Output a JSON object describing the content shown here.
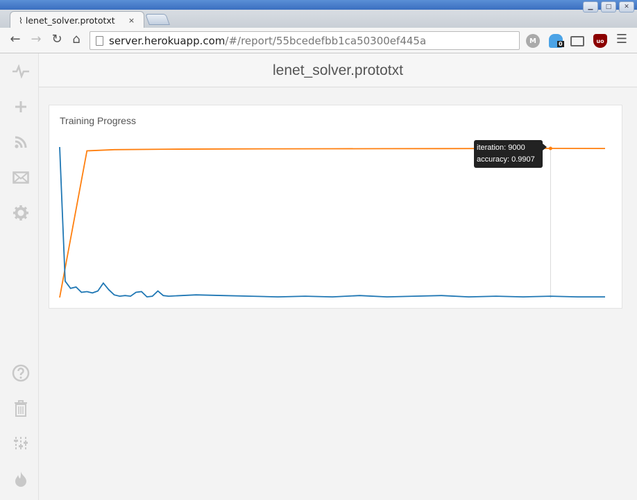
{
  "browser": {
    "tab_title": "lenet_solver.prototxt",
    "tab_close": "×",
    "url_host": "server.herokuapp.com",
    "url_path": "/#/report/55bcedefbb1ca50300ef445a",
    "extension_badge": "0"
  },
  "app": {
    "title": "lenet_solver.prototxt",
    "sidebar_icons": [
      "pulse-icon",
      "plus-icon",
      "rss-icon",
      "envelope-icon",
      "gear-icon",
      "help-icon",
      "trash-icon",
      "sliders-icon",
      "fire-icon"
    ]
  },
  "card": {
    "title": "Training Progress"
  },
  "tooltip": {
    "line1": "iteration: 9000",
    "line2": "accuracy: 0.9907"
  },
  "chart_data": {
    "type": "line",
    "title": "Training Progress",
    "x": [
      0,
      1000,
      2000,
      3000,
      4000,
      5000,
      6000,
      7000,
      8000,
      9000,
      10000
    ],
    "xlim": [
      0,
      10000
    ],
    "ylim": [
      0,
      1
    ],
    "grid": false,
    "series": [
      {
        "color": "#ff7f0e",
        "x": [
          0,
          500,
          1000,
          2000,
          3000,
          4000,
          5000,
          6000,
          7000,
          8000,
          9000,
          10000
        ],
        "values": [
          0.0,
          0.9748,
          0.9823,
          0.9856,
          0.9869,
          0.9878,
          0.9884,
          0.9891,
          0.9895,
          0.9901,
          0.9907,
          0.9903
        ]
      },
      {
        "color": "#1f77b4",
        "x": [
          0,
          100,
          200,
          300,
          400,
          500,
          600,
          700,
          800,
          900,
          1000,
          1100,
          1200,
          1300,
          1400,
          1500,
          1600,
          1700,
          1800,
          1900,
          2000,
          2500,
          3000,
          3500,
          4000,
          4500,
          5000,
          5500,
          6000,
          6500,
          7000,
          7500,
          8000,
          8500,
          9000,
          9500,
          10000
        ],
        "values": [
          2.3,
          0.25,
          0.14,
          0.16,
          0.08,
          0.09,
          0.07,
          0.1,
          0.22,
          0.12,
          0.04,
          0.02,
          0.03,
          0.02,
          0.08,
          0.09,
          0.01,
          0.02,
          0.1,
          0.03,
          0.02,
          0.04,
          0.03,
          0.02,
          0.01,
          0.02,
          0.01,
          0.03,
          0.01,
          0.02,
          0.03,
          0.01,
          0.02,
          0.01,
          0.02,
          0.01,
          0.01
        ]
      }
    ]
  }
}
